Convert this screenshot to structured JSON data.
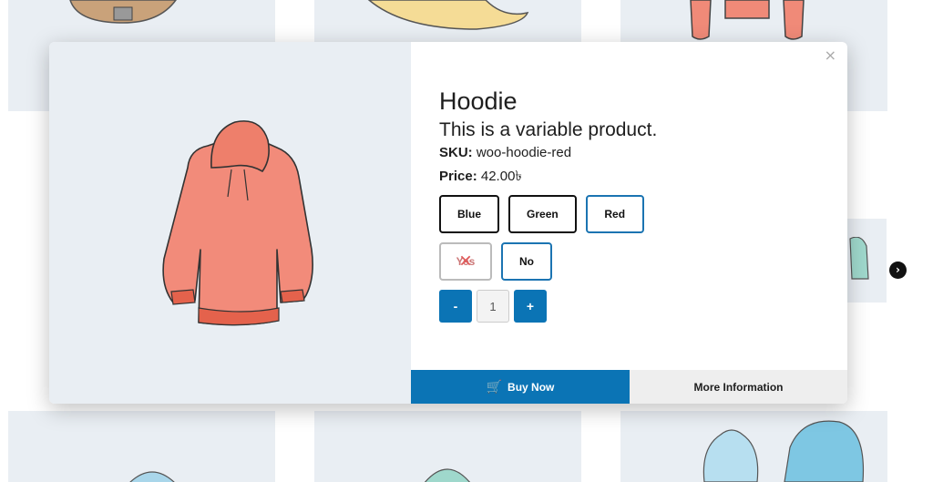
{
  "modal": {
    "close_label": "×",
    "product": {
      "title": "Hoodie",
      "description": "This is a variable product.",
      "sku_label": "SKU:",
      "sku_value": "woo-hoodie-red",
      "price_label": "Price:",
      "price_value": "42.00৳"
    },
    "color_options": [
      {
        "label": "Blue",
        "selected": false
      },
      {
        "label": "Green",
        "selected": false
      },
      {
        "label": "Red",
        "selected": true
      }
    ],
    "logo_options": [
      {
        "label": "Yes",
        "disabled": true
      },
      {
        "label": "No",
        "selected": true
      }
    ],
    "quantity": {
      "minus_label": "-",
      "value": "1",
      "plus_label": "+"
    },
    "buy_now_label": "Buy Now",
    "more_info_label": "More Information"
  },
  "carousel": {
    "next_icon": "chevron-right-icon"
  },
  "colors": {
    "accent": "#0b74b5",
    "tile_bg": "#e9eef3",
    "hoodie_red": "#f28b7a"
  }
}
